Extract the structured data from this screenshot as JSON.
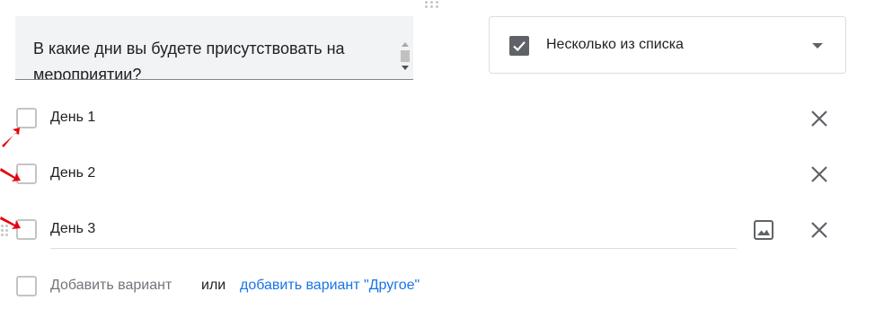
{
  "question": {
    "text": "В какие дни вы будете присутствовать на мероприятии?"
  },
  "question_type": {
    "label": "Несколько из списка",
    "icon": "checkbox-checked-icon"
  },
  "options": [
    {
      "label": "День 1"
    },
    {
      "label": "День 2"
    },
    {
      "label": "День 3"
    }
  ],
  "add_option": {
    "label": "Добавить вариант",
    "or_text": "или",
    "add_other_label": "добавить вариант \"Другое\""
  },
  "colors": {
    "accent_link": "#1a73e8",
    "annotation_arrow": "#e8000b",
    "icon_gray": "#5f6368"
  }
}
